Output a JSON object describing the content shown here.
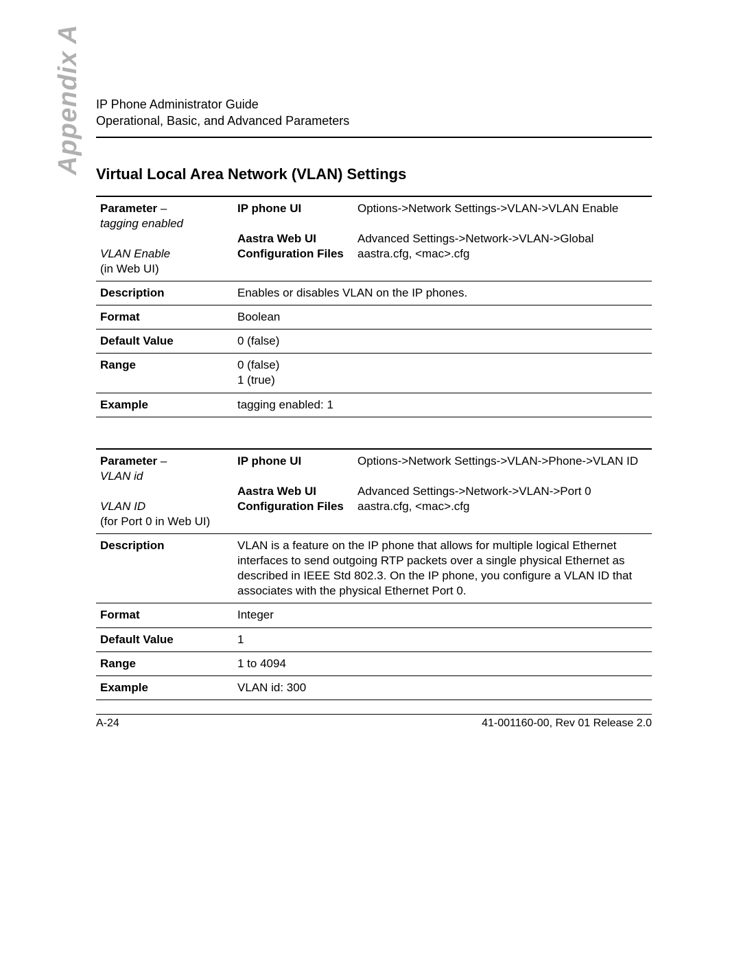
{
  "header": {
    "line1": "IP Phone Administrator Guide",
    "line2": "Operational, Basic, and Advanced Parameters"
  },
  "side_tab": "Appendix A",
  "section_title": "Virtual Local Area Network (VLAN) Settings",
  "table1": {
    "param_label_prefix": "Parameter",
    "param_dash": " – ",
    "param_name": "tagging enabled",
    "alt_name_line1": "VLAN Enable",
    "alt_name_line2": "(in Web UI)",
    "ip_phone_ui_label": "IP phone UI",
    "ip_phone_ui_value": "Options->Network Settings->VLAN->VLAN Enable",
    "aastra_web_ui_label": "Aastra Web UI",
    "aastra_web_ui_value": "Advanced Settings->Network->VLAN->Global",
    "config_files_label": "Configuration Files",
    "config_files_value": "aastra.cfg, <mac>.cfg",
    "rows": {
      "description_label": "Description",
      "description_value": "Enables or disables VLAN on the IP phones.",
      "format_label": "Format",
      "format_value": "Boolean",
      "default_label": "Default Value",
      "default_value": "0 (false)",
      "range_label": "Range",
      "range_value": "0 (false)\n1 (true)",
      "example_label": "Example",
      "example_value": "tagging enabled: 1"
    }
  },
  "table2": {
    "param_label_prefix": "Parameter",
    "param_dash": " – ",
    "param_name": "VLAN id",
    "alt_name_line1": "VLAN ID",
    "alt_name_line2": "(for Port 0 in Web UI)",
    "ip_phone_ui_label": "IP phone UI",
    "ip_phone_ui_value": "Options->Network Settings->VLAN->Phone->VLAN ID",
    "aastra_web_ui_label": "Aastra Web UI",
    "aastra_web_ui_value": "Advanced Settings->Network->VLAN->Port 0",
    "config_files_label": "Configuration Files",
    "config_files_value": "aastra.cfg, <mac>.cfg",
    "rows": {
      "description_label": "Description",
      "description_value": "VLAN is a feature on the IP phone that allows for multiple logical Ethernet interfaces to send outgoing RTP packets over a single physical Ethernet as described in IEEE Std 802.3. On the IP phone, you configure a VLAN ID that associates with the physical Ethernet Port 0.",
      "format_label": "Format",
      "format_value": "Integer",
      "default_label": "Default Value",
      "default_value": "1",
      "range_label": "Range",
      "range_value": "1 to 4094",
      "example_label": "Example",
      "example_value": "VLAN id: 300"
    }
  },
  "footer": {
    "left": "A-24",
    "right": "41-001160-00, Rev 01  Release 2.0"
  }
}
